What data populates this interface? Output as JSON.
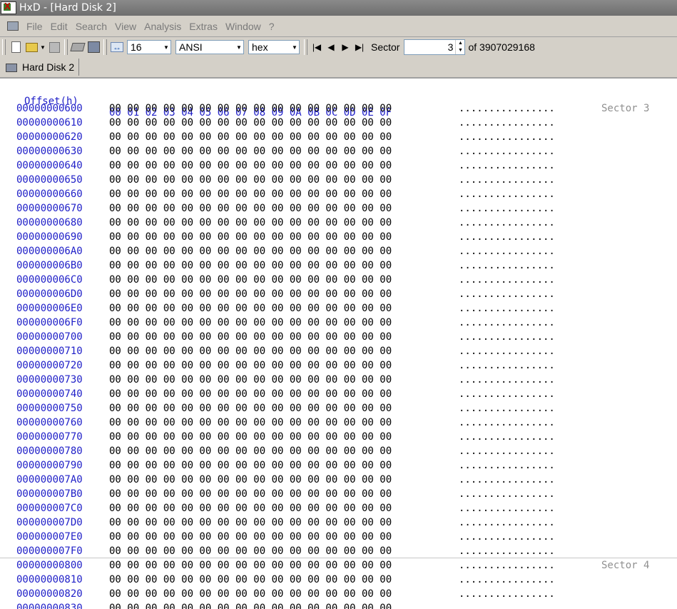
{
  "window": {
    "title": "HxD - [Hard Disk 2]"
  },
  "menu": [
    "File",
    "Edit",
    "Search",
    "View",
    "Analysis",
    "Extras",
    "Window",
    "?"
  ],
  "toolbar": {
    "bytes_per_row": "16",
    "charset": "ANSI",
    "offset_base": "hex",
    "sector_label": "Sector",
    "sector_value": "3",
    "sector_total": "of 3907029168"
  },
  "tab": {
    "label": "Hard Disk 2"
  },
  "hex": {
    "offset_header": "Offset(h)",
    "column_header": "00 01 02 03 04 05 06 07 08 09 0A 0B 0C 0D 0E 0F",
    "byte_row": "00 00 00 00 00 00 00 00 00 00 00 00 00 00 00 00",
    "ascii_row": "................",
    "rows": [
      {
        "offset": "00000000600",
        "sector": "Sector 3"
      },
      {
        "offset": "00000000610"
      },
      {
        "offset": "00000000620"
      },
      {
        "offset": "00000000630"
      },
      {
        "offset": "00000000640"
      },
      {
        "offset": "00000000650"
      },
      {
        "offset": "00000000660"
      },
      {
        "offset": "00000000670"
      },
      {
        "offset": "00000000680"
      },
      {
        "offset": "00000000690"
      },
      {
        "offset": "000000006A0"
      },
      {
        "offset": "000000006B0"
      },
      {
        "offset": "000000006C0"
      },
      {
        "offset": "000000006D0"
      },
      {
        "offset": "000000006E0"
      },
      {
        "offset": "000000006F0"
      },
      {
        "offset": "00000000700"
      },
      {
        "offset": "00000000710"
      },
      {
        "offset": "00000000720"
      },
      {
        "offset": "00000000730"
      },
      {
        "offset": "00000000740"
      },
      {
        "offset": "00000000750"
      },
      {
        "offset": "00000000760"
      },
      {
        "offset": "00000000770"
      },
      {
        "offset": "00000000780"
      },
      {
        "offset": "00000000790"
      },
      {
        "offset": "000000007A0"
      },
      {
        "offset": "000000007B0"
      },
      {
        "offset": "000000007C0"
      },
      {
        "offset": "000000007D0"
      },
      {
        "offset": "000000007E0"
      },
      {
        "offset": "000000007F0"
      },
      {
        "offset": "00000000800",
        "sector": "Sector 4"
      },
      {
        "offset": "00000000810"
      },
      {
        "offset": "00000000820"
      },
      {
        "offset": "00000000830"
      }
    ]
  }
}
